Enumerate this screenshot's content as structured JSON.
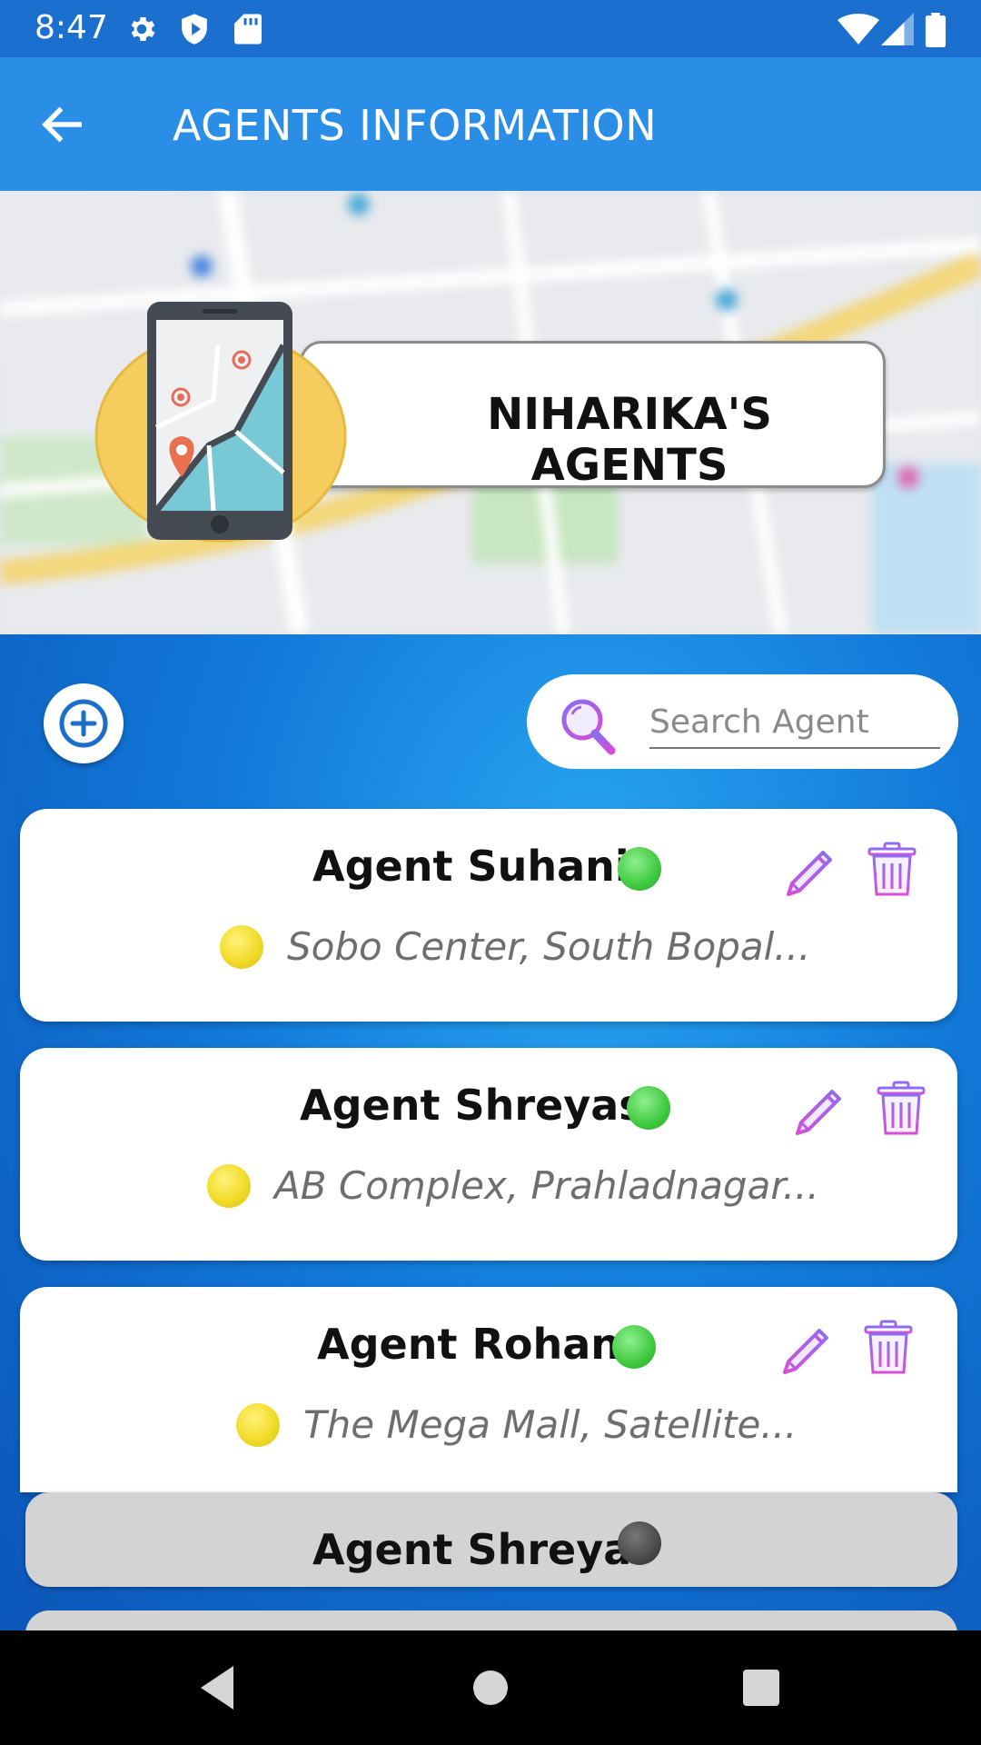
{
  "status_bar": {
    "time": "8:47",
    "left_icons": [
      "settings-icon",
      "shield-icon",
      "sd-card-icon"
    ],
    "right_icons": [
      "wifi-icon",
      "signal-icon",
      "battery-icon"
    ]
  },
  "app_bar": {
    "title": "AGENTS INFORMATION",
    "back_icon": "arrow-left-icon"
  },
  "header": {
    "banner_text": "NIHARIKA'S AGENTS",
    "emblem": "phone-map-icon"
  },
  "search": {
    "placeholder": "Search Agent",
    "value": ""
  },
  "agents": [
    {
      "name": "Agent Suhani",
      "address": "Sobo Center, South Bopal...",
      "status": "online",
      "status_color": "#3fc93f"
    },
    {
      "name": "Agent Shreyas",
      "address": "AB Complex, Prahladnagar...",
      "status": "online",
      "status_color": "#3fc93f"
    },
    {
      "name": "Agent Rohan",
      "address": "The Mega Mall, Satellite...",
      "status": "online",
      "status_color": "#3fc93f"
    }
  ],
  "inactive_agents": [
    {
      "name": "Agent Shreya",
      "status": "offline",
      "status_color": "#4a4a4a"
    }
  ],
  "colors": {
    "app_bar": "#2a8ee6",
    "status_bar": "#1b6fcf",
    "action_icon_gradient": [
      "#a86cf0",
      "#d04ee0"
    ]
  },
  "nav_bar": {
    "buttons": [
      "back-triangle-icon",
      "home-circle-icon",
      "recents-square-icon"
    ]
  }
}
